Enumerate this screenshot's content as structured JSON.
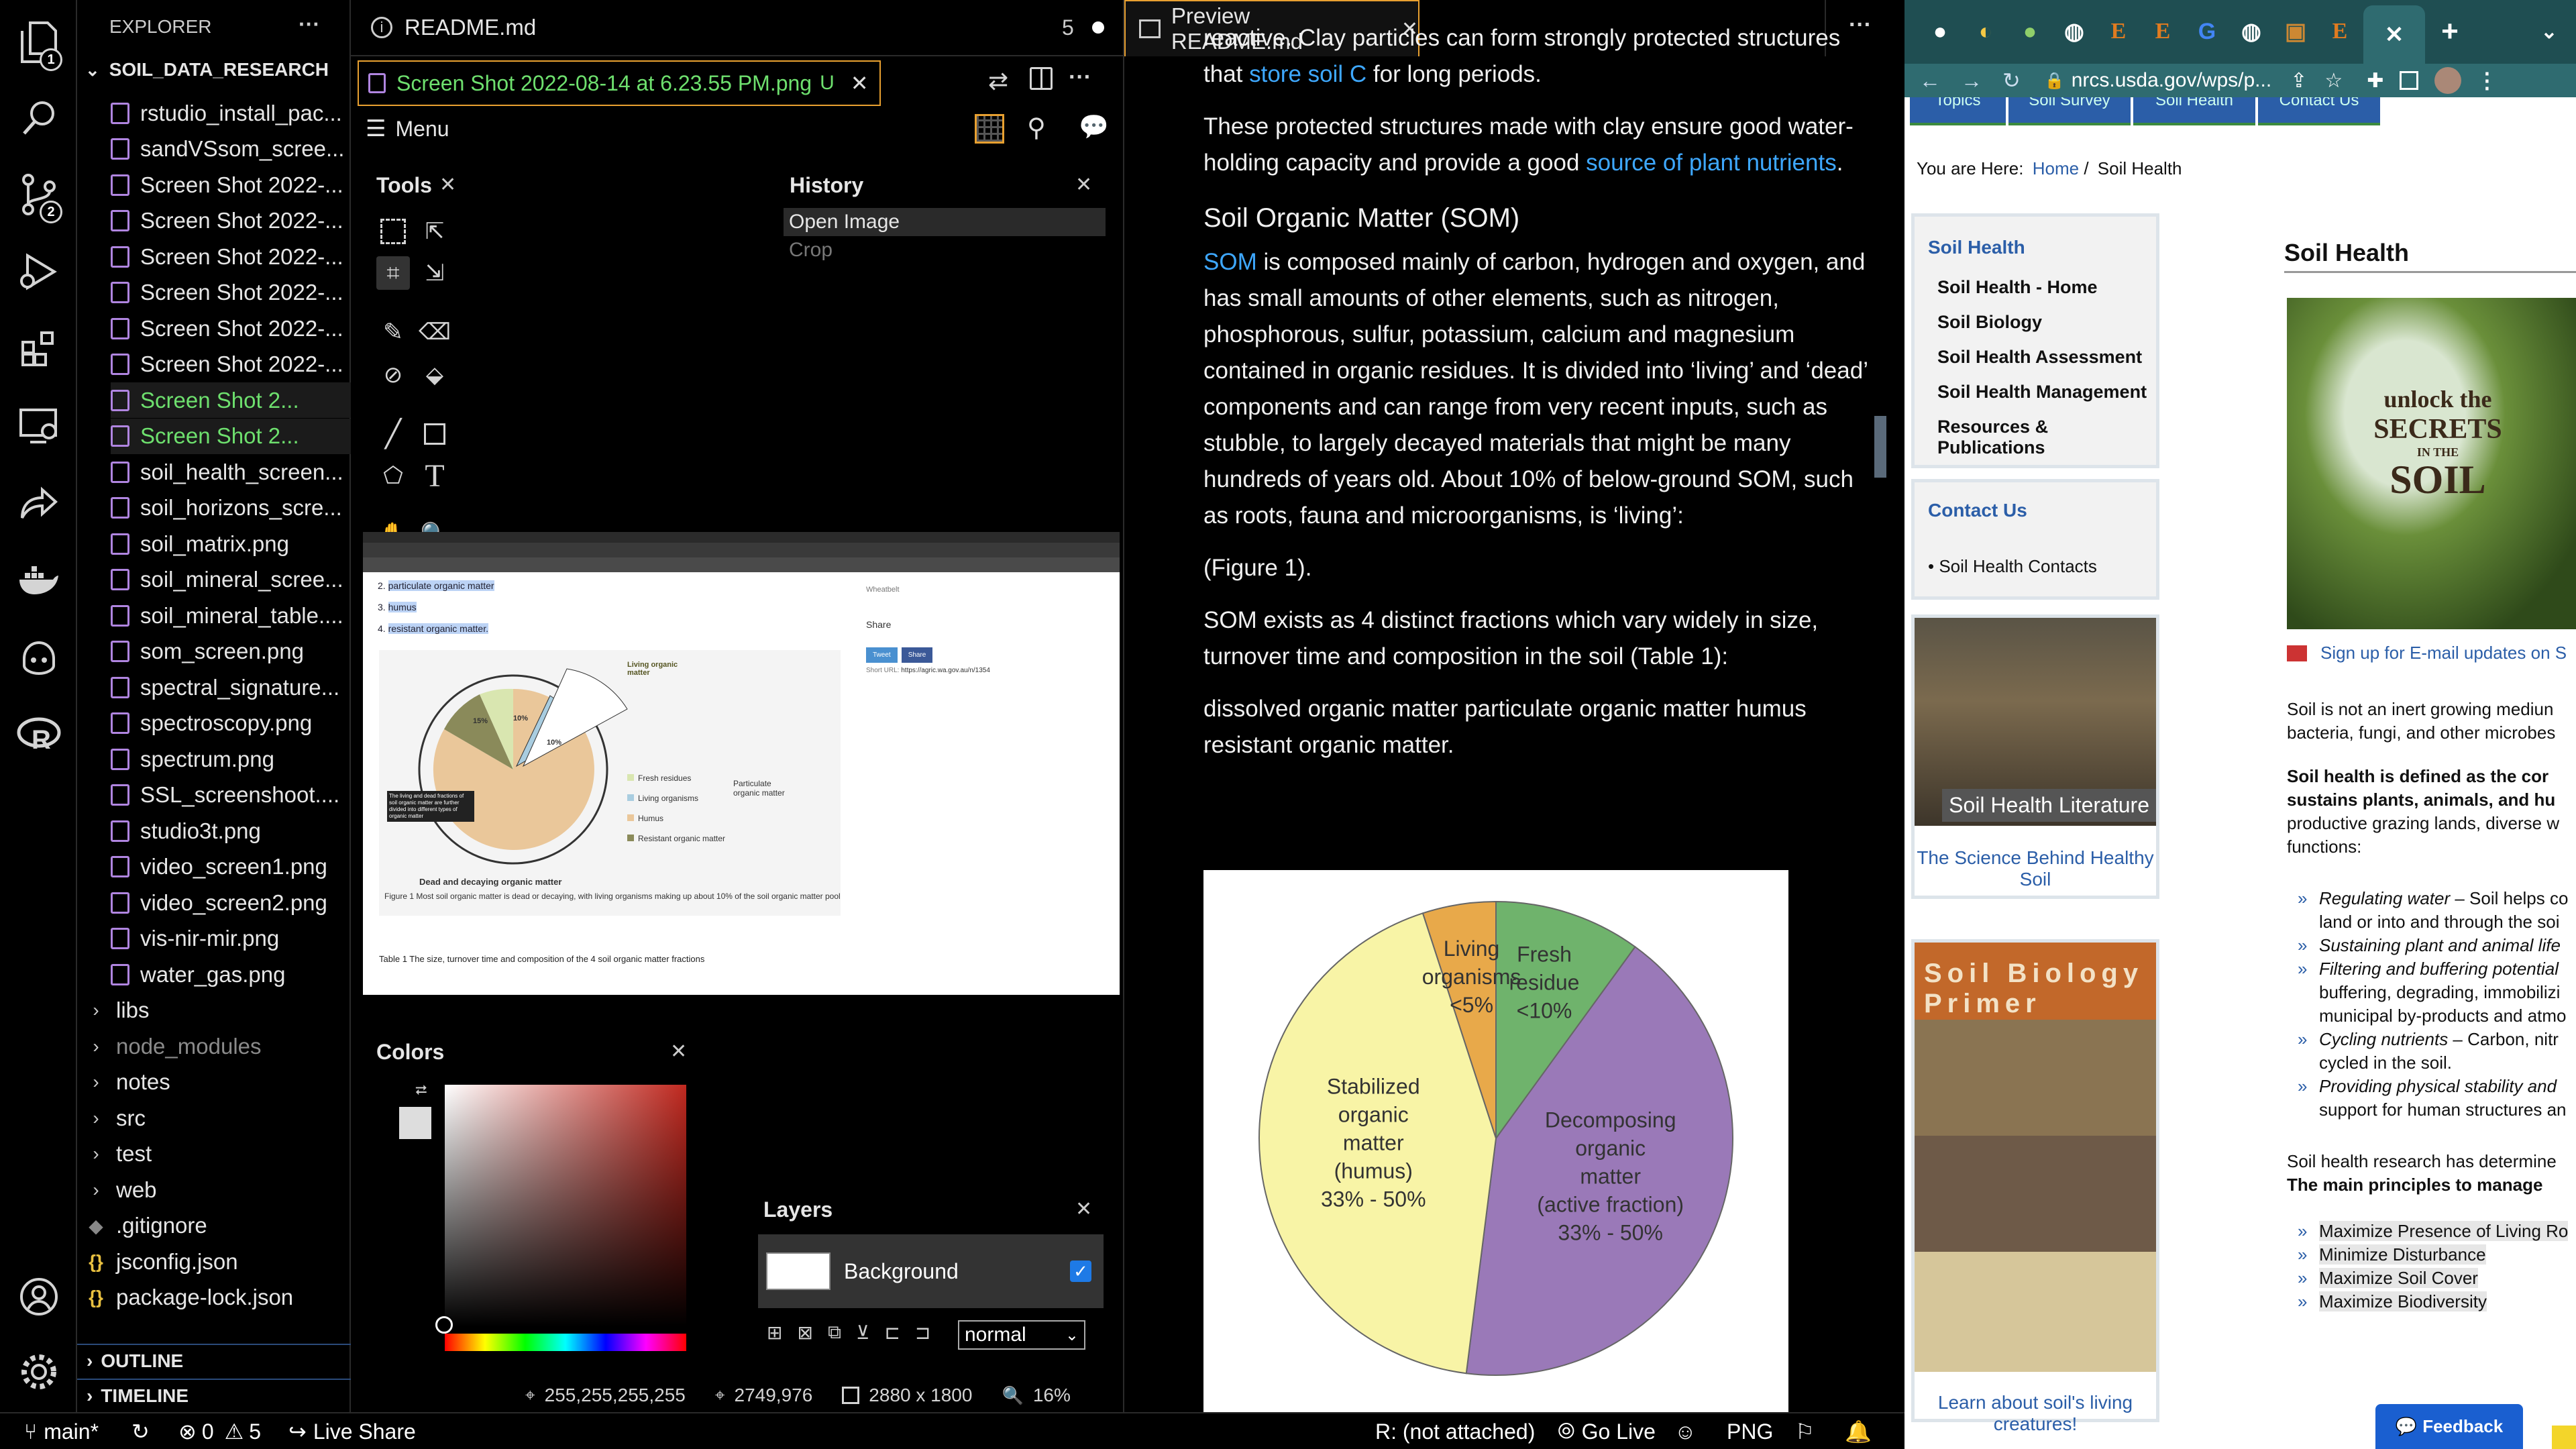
{
  "activity_bar": {
    "icons": [
      "files-icon",
      "search-icon",
      "source-control-icon",
      "run-debug-icon",
      "extensions-icon",
      "remote-explorer-icon",
      "live-share-icon",
      "docker-icon",
      "copilot-icon",
      "r-icon"
    ],
    "badges": {
      "files": "1",
      "scm": "2"
    },
    "bottom_icons": [
      "account-icon",
      "settings-icon"
    ]
  },
  "explorer": {
    "title": "EXPLORER",
    "more": "···",
    "folder": "SOIL_DATA_RESEARCH",
    "files": [
      {
        "name": "rstudio_install_pac...",
        "git": "",
        "hl": false
      },
      {
        "name": "sandVSsom_scree...",
        "git": "",
        "hl": false
      },
      {
        "name": "Screen Shot 2022-...",
        "git": "",
        "hl": false
      },
      {
        "name": "Screen Shot 2022-...",
        "git": "",
        "hl": false
      },
      {
        "name": "Screen Shot 2022-...",
        "git": "",
        "hl": false
      },
      {
        "name": "Screen Shot 2022-...",
        "git": "",
        "hl": false
      },
      {
        "name": "Screen Shot 2022-...",
        "git": "",
        "hl": false
      },
      {
        "name": "Screen Shot 2022-...",
        "git": "",
        "hl": false
      },
      {
        "name": "Screen Shot 2...",
        "git": "U",
        "hl": true
      },
      {
        "name": "Screen Shot 2...",
        "git": "U",
        "hl": true
      },
      {
        "name": "soil_health_screen...",
        "git": "",
        "hl": false
      },
      {
        "name": "soil_horizons_scre...",
        "git": "",
        "hl": false
      },
      {
        "name": "soil_matrix.png",
        "git": "",
        "hl": false
      },
      {
        "name": "soil_mineral_scree...",
        "git": "",
        "hl": false
      },
      {
        "name": "soil_mineral_table....",
        "git": "",
        "hl": false
      },
      {
        "name": "som_screen.png",
        "git": "",
        "hl": false
      },
      {
        "name": "spectral_signature...",
        "git": "",
        "hl": false
      },
      {
        "name": "spectroscopy.png",
        "git": "",
        "hl": false
      },
      {
        "name": "spectrum.png",
        "git": "",
        "hl": false
      },
      {
        "name": "SSL_screenshoot....",
        "git": "",
        "hl": false
      },
      {
        "name": "studio3t.png",
        "git": "",
        "hl": false
      },
      {
        "name": "video_screen1.png",
        "git": "",
        "hl": false
      },
      {
        "name": "video_screen2.png",
        "git": "",
        "hl": false
      },
      {
        "name": "vis-nir-mir.png",
        "git": "",
        "hl": false
      },
      {
        "name": "water_gas.png",
        "git": "",
        "hl": false
      }
    ],
    "folders": [
      "libs",
      "node_modules",
      "notes",
      "src",
      "test",
      "web"
    ],
    "root_files": [
      ".gitignore",
      "jsconfig.json",
      "package-lock.json"
    ],
    "outline": "OUTLINE",
    "timeline": "TIMELINE"
  },
  "middle": {
    "tab_label": "README.md",
    "tab_count": "5",
    "subtab_label": "Screen Shot 2022-08-14 at 6.23.55 PM.png",
    "subtab_git": "U",
    "menu": "Menu",
    "tools_title": "Tools",
    "history_title": "History",
    "history_items": [
      "Open Image",
      "Crop"
    ],
    "colors_title": "Colors",
    "layers_title": "Layers",
    "layer_name": "Background",
    "blend_mode": "normal",
    "status": {
      "color": "255,255,255,255",
      "pos": "2749,976",
      "size": "2880 x 1800",
      "zoom": "16%"
    },
    "inner": {
      "list_items": [
        "particulate organic matter",
        "humus",
        "resistant organic matter."
      ],
      "inner_pie_labels": [
        "Living organic matter",
        "15%",
        "10%",
        "10%"
      ],
      "legend": [
        "Fresh residues",
        "Living organisms",
        "Humus",
        "Resistant organic matter"
      ],
      "particulate": "Particulate organic matter",
      "note": "The living and dead fractions of soil organic matter are further divided into different types of organic matter",
      "pie_caption": "Dead and decaying organic matter",
      "figure_caption": "Figure 1 Most soil organic matter is dead or decaying, with living organisms making up about 10% of the soil organic matter pool",
      "table_caption": "Table 1 The size, turnover time and composition of the 4 soil organic matter fractions",
      "share": "Share",
      "tweet": "Tweet",
      "fb": "Share",
      "short_url_label": "Short URL:",
      "short_url": "https://agric.wa.gov.au/n/1354",
      "wheatbelt": "Wheatbelt"
    }
  },
  "preview": {
    "tab_label": "Preview README.md",
    "p0_a": "reactive. Clay particles can form strongly protected structures that ",
    "p0_link": "store soil C",
    "p0_b": " for long periods.",
    "p1_a": "These protected structures made with clay ensure good water-holding capacity and provide a good ",
    "p1_link": "source of plant nutrients",
    "p1_b": ".",
    "h_som": "Soil Organic Matter (SOM)",
    "p2_link": "SOM",
    "p2": " is composed mainly of carbon, hydrogen and oxygen, and has small amounts of other elements, such as nitrogen, phosphorous, sulfur, potassium, calcium and magnesium contained in organic residues. It is divided into ‘living’ and ‘dead’ components and can range from very recent inputs, such as stubble, to largely decayed materials that might be many hundreds of years old. About 10% of below-ground SOM, such as roots, fauna and microorganisms, is ‘living’:",
    "p3": "(Figure 1).",
    "p4": "SOM exists as 4 distinct fractions which vary widely in size, turnover time and composition in the soil (Table 1):",
    "p5": "dissolved organic matter particulate organic matter humus resistant organic matter.",
    "pie_labels": [
      {
        "lines": [
          "Living",
          "organisms",
          "<5%"
        ]
      },
      {
        "lines": [
          "Fresh",
          "residue",
          "<10%"
        ]
      },
      {
        "lines": [
          "Decomposing",
          "organic",
          "matter",
          "(active fraction)",
          "33% - 50%"
        ]
      },
      {
        "lines": [
          "Stabilized",
          "organic",
          "matter",
          "(humus)",
          "33% - 50%"
        ]
      }
    ]
  },
  "chart_data": {
    "type": "pie",
    "categories": [
      "Living organisms",
      "Fresh residue",
      "Decomposing organic matter (active fraction)",
      "Stabilized organic matter (humus)"
    ],
    "values": [
      5,
      10,
      42,
      43
    ],
    "colors": [
      "#e8a94a",
      "#6fb36c",
      "#9a79b8",
      "#f8f4a6"
    ]
  },
  "browser": {
    "url": "nrcs.usda.gov/wps/p...",
    "breadcrumb_label": "You are Here:",
    "breadcrumb_home": "Home",
    "breadcrumb_sep": "/",
    "breadcrumb_current": "Soil Health",
    "top_nav": [
      "Topics",
      "Soil Survey",
      "Soil Health",
      "Contact Us"
    ],
    "side_title": "Soil Health",
    "side_links": [
      "Soil Health - Home",
      "Soil Biology",
      "Soil Health Assessment",
      "Soil Health Management",
      "Resources & Publications"
    ],
    "contact_title": "Contact Us",
    "contact_link": "• Soil Health Contacts",
    "lit_banner": "Soil Health Literature",
    "lit_link": "The Science Behind Healthy Soil",
    "primer_banner": "Soil Biology Primer",
    "primer_link": "Learn about soil's living creatures!",
    "main_title": "Soil Health",
    "secret_text": [
      "unlock the",
      "SECRETS",
      "IN THE",
      "SOIL"
    ],
    "signup": "Sign up for E-mail updates on S",
    "intro": "Soil is not an inert growing mediun bacteria, fungi, and other microbes",
    "def_bold": "Soil health is defined as the cor sustains plants, animals, and hu",
    "def_rest": "productive grazing lands, diverse w functions:",
    "bullets": [
      {
        "em": "Regulating water",
        "rest": " – Soil helps co land or into and through the soi"
      },
      {
        "em": "Sustaining plant and animal life",
        "rest": ""
      },
      {
        "em": "Filtering and buffering potential",
        "rest": " buffering, degrading, immobilizi municipal by-products and atmo"
      },
      {
        "em": "Cycling nutrients",
        "rest": " – Carbon, nitr cycled in the soil."
      },
      {
        "em": "Providing physical stability and",
        "rest": " support for human structures an"
      }
    ],
    "research": "Soil health research has determine",
    "principles": "The main principles to manage",
    "principle_items": [
      "Maximize Presence of Living Ro",
      "Minimize Disturbance",
      "Maximize Soil Cover",
      "Maximize Biodiversity"
    ],
    "feedback": "Feedback"
  },
  "statusbar": {
    "branch": "main*",
    "errors": "0",
    "warnings": "5",
    "live_share": "Live Share",
    "r_status": "R: (not attached)",
    "go_live": "Go Live",
    "lang": "PNG"
  }
}
